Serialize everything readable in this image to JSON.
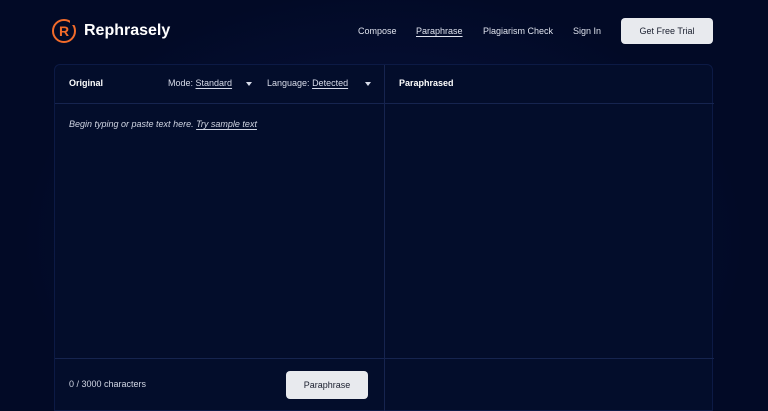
{
  "brand": {
    "logo_letter": "R",
    "name": "Rephrasely",
    "accent_color": "#f26b2a"
  },
  "nav": {
    "items": [
      {
        "label": "Compose"
      },
      {
        "label": "Paraphrase",
        "active": true
      },
      {
        "label": "Plagiarism Check"
      },
      {
        "label": "Sign In"
      }
    ],
    "cta_label": "Get Free Trial"
  },
  "editor": {
    "original_title": "Original",
    "mode_label": "Mode:",
    "mode_value": "Standard",
    "language_label": "Language:",
    "language_value": "Detected",
    "placeholder": "Begin typing or paste text here.",
    "sample_link": "Try sample text",
    "char_count": "0 / 3000 characters",
    "submit_label": "Paraphrase",
    "paraphrased_title": "Paraphrased"
  },
  "colors": {
    "background": "#020a26",
    "panel": "#030d2b",
    "button_bg": "#e8eaee"
  }
}
